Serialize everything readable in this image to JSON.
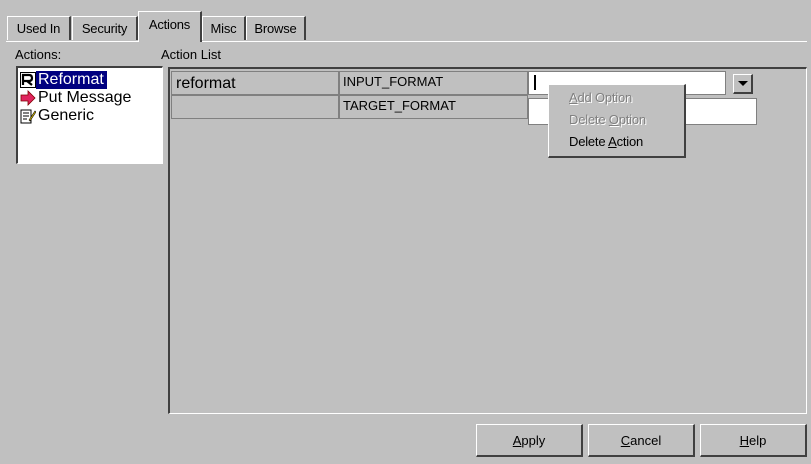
{
  "tabs": [
    {
      "label": "Used In",
      "active": false
    },
    {
      "label": "Security",
      "active": false
    },
    {
      "label": "Actions",
      "active": true
    },
    {
      "label": "Misc",
      "active": false
    },
    {
      "label": "Browse",
      "active": false
    }
  ],
  "actions_label": "Actions:",
  "action_list_label": "Action List",
  "actions": [
    {
      "label": "Reformat",
      "icon": "reformat-icon",
      "selected": true
    },
    {
      "label": "Put Message",
      "icon": "arrow-right-icon",
      "selected": false
    },
    {
      "label": "Generic",
      "icon": "notepad-edit-icon",
      "selected": false
    }
  ],
  "action_rows": [
    {
      "name": "reformat",
      "option": "INPUT_FORMAT",
      "value": ""
    },
    {
      "name": "",
      "option": "TARGET_FORMAT",
      "value": ""
    }
  ],
  "context_menu": {
    "items": [
      {
        "pre": "",
        "key": "A",
        "post": "dd Option",
        "enabled": false
      },
      {
        "pre": "Delete ",
        "key": "O",
        "post": "ption",
        "enabled": false
      },
      {
        "pre": "Delete ",
        "key": "A",
        "post": "ction",
        "enabled": true
      }
    ]
  },
  "buttons": [
    {
      "pre": "",
      "key": "A",
      "post": "pply"
    },
    {
      "pre": "",
      "key": "C",
      "post": "ancel"
    },
    {
      "pre": "",
      "key": "H",
      "post": "elp"
    }
  ],
  "colors": {
    "face": "#c0c0c0",
    "highlight": "#000080",
    "window": "#ffffff"
  }
}
